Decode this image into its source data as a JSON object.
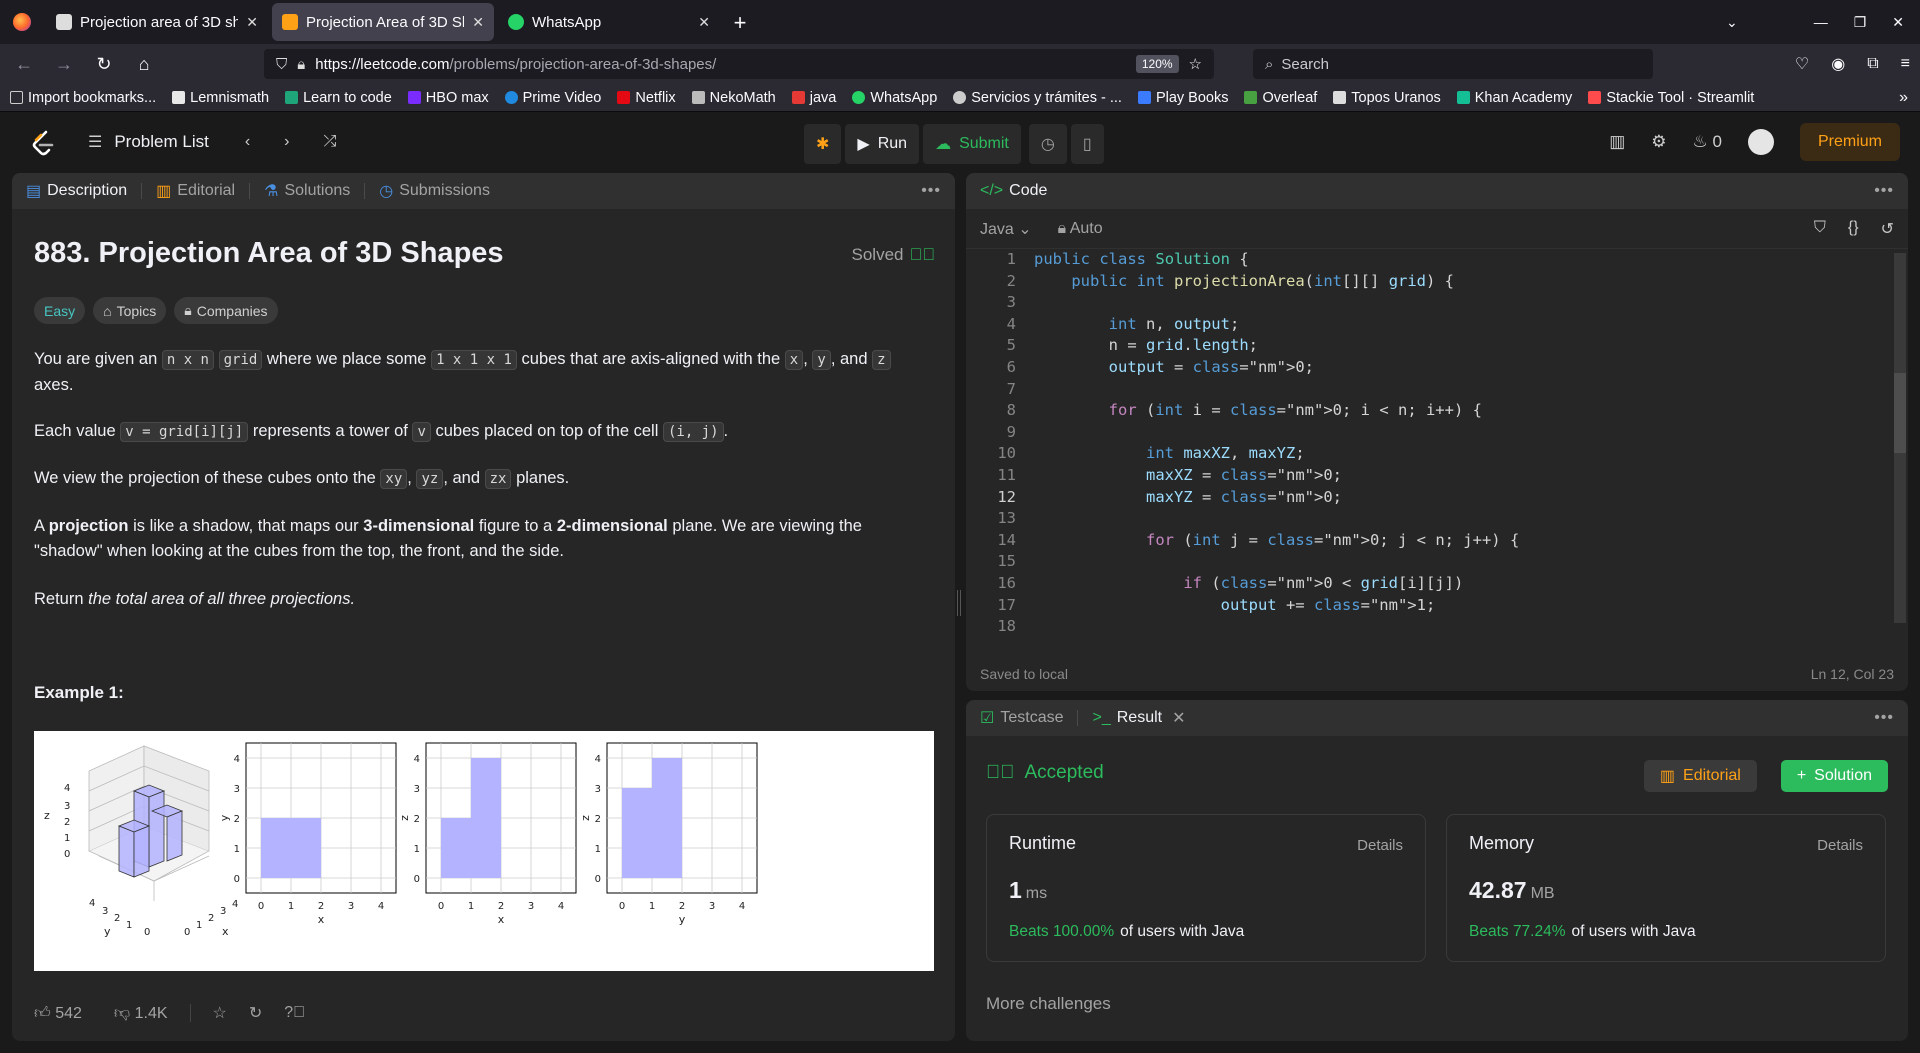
{
  "browser": {
    "tabs": [
      {
        "title": "Projection area of 3D sha",
        "active": false
      },
      {
        "title": "Projection Area of 3D Sh",
        "active": true
      },
      {
        "title": "WhatsApp",
        "active": false
      }
    ],
    "url_host": "https://leetcode.com",
    "url_path": "/problems/projection-area-of-3d-shapes/",
    "zoom": "120%",
    "search_placeholder": "Search",
    "bookmarks": [
      "Import bookmarks...",
      "Lemnismath",
      "Learn to code",
      "HBO max",
      "Prime Video",
      "Netflix",
      "NekoMath",
      "java",
      "WhatsApp",
      "Servicios y trámites - ...",
      "Play Books",
      "Overleaf",
      "Topos Uranos",
      "Khan Academy",
      "Stackie Tool · Streamlit"
    ]
  },
  "header": {
    "problem_list": "Problem List",
    "run": "Run",
    "submit": "Submit",
    "streak": "0",
    "premium": "Premium"
  },
  "description": {
    "tabs": [
      "Description",
      "Editorial",
      "Solutions",
      "Submissions"
    ],
    "title": "883. Projection Area of 3D Shapes",
    "solved": "Solved",
    "difficulty": "Easy",
    "topics": "Topics",
    "companies": "Companies",
    "p1": {
      "a": "You are given an",
      "c1": "n x n",
      "c2": "grid",
      "b": "where we place some",
      "c3": "1 x 1 x 1",
      "d": "cubes that are axis-aligned with the",
      "c4": "x",
      "c5": "y",
      "e": "and",
      "c6": "z",
      "f": "axes."
    },
    "p2": {
      "a": "Each value",
      "c1": "v = grid[i][j]",
      "b": "represents a tower of",
      "c2": "v",
      "d": "cubes placed on top of the cell",
      "c3": "(i, j)"
    },
    "p3": {
      "a": "We view the projection of these cubes onto the",
      "c1": "xy",
      "c2": "yz",
      "b": "and",
      "c3": "zx",
      "d": "planes."
    },
    "p4": {
      "a": "A",
      "b1": "projection",
      "c": "is like a shadow, that maps our",
      "b2": "3-dimensional",
      "d": "figure to a",
      "b3": "2-dimensional",
      "e": "plane. We are viewing the \"shadow\" when looking at the cubes from the top, the front, and the side."
    },
    "p5": {
      "a": "Return",
      "i": "the total area of all three projections."
    },
    "example_title": "Example 1:",
    "likes": "542",
    "dislikes": "1.4K"
  },
  "figure": {
    "plots": [
      {
        "xlabel": "x",
        "ylabel": "y",
        "bars": [
          [
            0,
            2,
            2
          ]
        ]
      },
      {
        "xlabel": "x",
        "ylabel": "z",
        "bars": [
          [
            0,
            1,
            2
          ],
          [
            1,
            2,
            4
          ]
        ]
      },
      {
        "xlabel": "y",
        "ylabel": "z",
        "bars": [
          [
            0,
            1,
            3
          ],
          [
            1,
            2,
            4
          ]
        ]
      }
    ],
    "ticks": [
      "0",
      "1",
      "2",
      "3",
      "4"
    ],
    "iso_labels": {
      "z": "z",
      "x": "x",
      "y": "y"
    }
  },
  "code": {
    "title": "Code",
    "language": "Java",
    "mode": "Auto",
    "status": "Saved to local",
    "cursor": "Ln 12, Col 23",
    "lines": [
      "public class Solution {",
      "    public int projectionArea(int[][] grid) {",
      "",
      "        int n, output;",
      "        n = grid.length;",
      "        output = 0;",
      "",
      "        for (int i = 0; i < n; i++) {",
      "",
      "            int maxXZ, maxYZ;",
      "            maxXZ = 0;",
      "            maxYZ = 0;",
      "",
      "            for (int j = 0; j < n; j++) {",
      "",
      "                if (0 < grid[i][j])",
      "                    output += 1;",
      ""
    ]
  },
  "result": {
    "tabs": [
      "Testcase",
      "Result"
    ],
    "status": "Accepted",
    "editorial_btn": "Editorial",
    "solution_btn": "Solution",
    "runtime": {
      "label": "Runtime",
      "details": "Details",
      "value": "1",
      "unit": "ms",
      "beats": "Beats 100.00%",
      "suffix": "of users with Java"
    },
    "memory": {
      "label": "Memory",
      "details": "Details",
      "value": "42.87",
      "unit": "MB",
      "beats": "Beats 77.24%",
      "suffix": "of users with Java"
    },
    "more": "More challenges"
  }
}
